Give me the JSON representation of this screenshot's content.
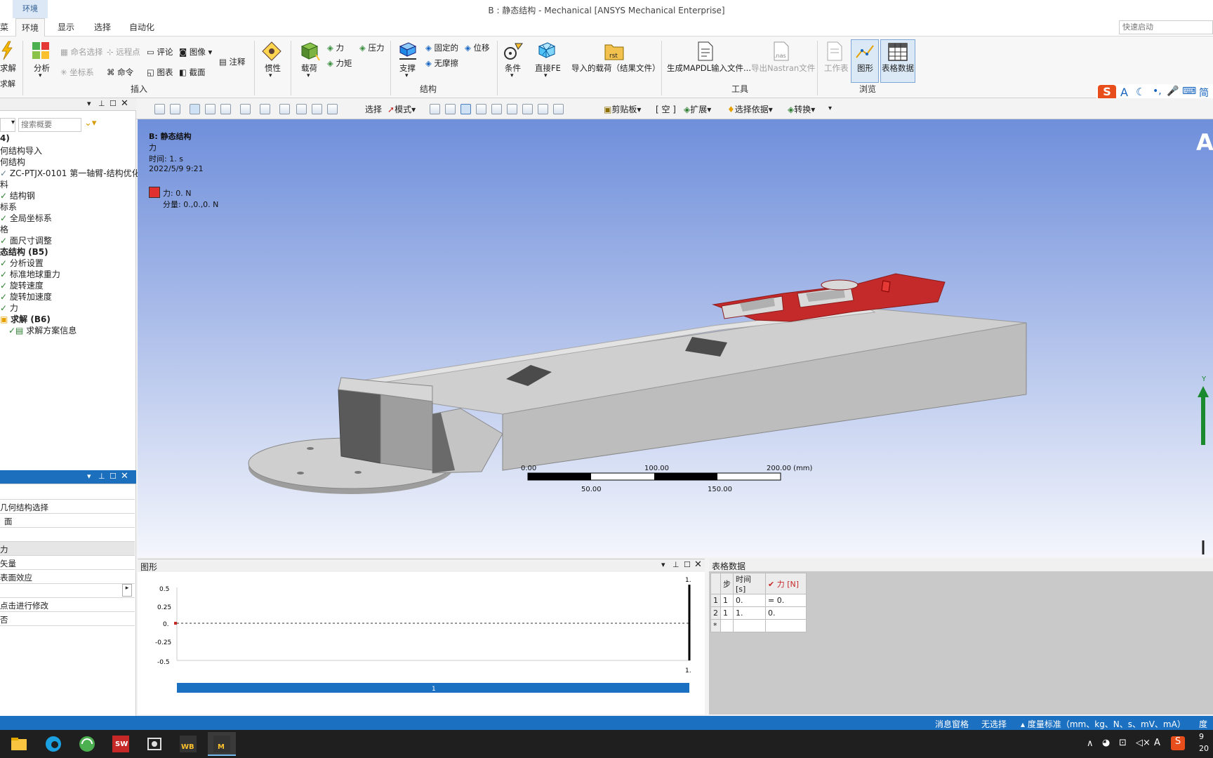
{
  "window": {
    "title": "B : 静态结构 - Mechanical [ANSYS Mechanical Enterprise]",
    "context_tab": "环境"
  },
  "tabs": [
    "环境",
    "显示",
    "选择",
    "自动化"
  ],
  "tab_cut": "菜",
  "quick_launch_placeholder": "快速启动",
  "ribbon": {
    "solve": "求解",
    "solve_sub": "求解",
    "analysis": "分析",
    "named_selection": "命名选择",
    "remote_point": "远程点",
    "comment": "评论",
    "image": "图像",
    "coord_system": "坐标系",
    "command": "命令",
    "chart": "图表",
    "section": "截面",
    "annotation": "注释",
    "group_insert": "插入",
    "inertia": "惯性",
    "loads": "载荷",
    "force": "力",
    "pressure": "压力",
    "moment": "力矩",
    "supports": "支撑",
    "fixed": "固定的",
    "displacement": "位移",
    "frictionless": "无摩擦",
    "group_structure": "结构",
    "conditions": "条件",
    "direct_fe": "直接FE",
    "imported_loads": "导入的载荷（结果文件）",
    "rst_label": "rst",
    "gen_mapdl": "生成MAPDL输入文件...",
    "export_nastran": "导出Nastran文件",
    "nas_label": ".nas",
    "group_tools": "工具",
    "worksheet": "工作表",
    "graph": "图形",
    "tabular": "表格数据",
    "group_browse": "浏览"
  },
  "ime": {
    "logo": "S",
    "items": [
      "A",
      "☾",
      "•,",
      "🎤",
      "⌨",
      "简"
    ]
  },
  "toolbar": {
    "select": "选择",
    "mode": "模式",
    "clipboard": "剪贴板",
    "empty": "[ 空 ]",
    "extend": "扩展",
    "select_by": "选择依据",
    "convert": "转换"
  },
  "outline": {
    "search_placeholder": "搜索概要",
    "items": [
      {
        "text": "4)",
        "bold": true
      },
      {
        "text": "何结构导入"
      },
      {
        "text": "何结构"
      },
      {
        "text": "ZC-PTJX-0101 第一轴臂-结构优化"
      },
      {
        "text": "料"
      },
      {
        "text": "结构钢"
      },
      {
        "text": "标系"
      },
      {
        "text": "全局坐标系"
      },
      {
        "text": "格"
      },
      {
        "text": "面尺寸调整"
      },
      {
        "text": "态结构 (B5)",
        "bold": true
      },
      {
        "text": "分析设置"
      },
      {
        "text": "标准地球重力"
      },
      {
        "text": "旋转速度"
      },
      {
        "text": "旋转加速度"
      },
      {
        "text": "力"
      },
      {
        "text": "求解 (B6)",
        "bold": true
      },
      {
        "text": "求解方案信息"
      }
    ]
  },
  "details": {
    "rows": [
      "",
      "几何结构选择",
      "面",
      "",
      "力",
      "矢量",
      "表面效应",
      "",
      "点击进行修改",
      "否"
    ]
  },
  "viewport": {
    "title": "B: 静态结构",
    "load": "力",
    "time": "时间: 1. s",
    "date": "2022/5/9 9:21",
    "legend_label": "力: 0. N",
    "legend_components": "分量: 0.,0.,0. N",
    "legend_color": "#e03030",
    "scale": {
      "labels_top": [
        "0.00",
        "100.00",
        "200.00 (mm)"
      ],
      "labels_bottom": [
        "50.00",
        "150.00"
      ]
    },
    "brand_letter": "A",
    "axis_label": "Y"
  },
  "graph_panel": {
    "title": "图形",
    "y_ticks": [
      "0.5",
      "0.25",
      "0.",
      "-0.25",
      "-0.5"
    ],
    "right_top": "1.",
    "right_bottom": "1.",
    "timeline_label": "1"
  },
  "tabular_panel": {
    "title": "表格数据",
    "columns": [
      "",
      "步",
      "时间 [s]",
      "✔ 力 [N]"
    ],
    "rows": [
      [
        "1",
        "1",
        "0.",
        "= 0."
      ],
      [
        "2",
        "1",
        "1.",
        "0."
      ],
      [
        "*",
        "",
        "",
        ""
      ]
    ]
  },
  "statusbar": {
    "messages": "消息窗格",
    "no_selection": "无选择",
    "units": "度量标准（mm、kg、N、s、mV、mA）",
    "degrees": "度"
  },
  "taskbar": {
    "clock_top": "9",
    "clock_bottom": "20"
  }
}
